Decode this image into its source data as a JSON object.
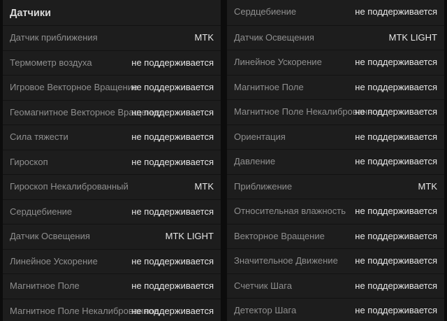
{
  "left": {
    "title": "Датчики",
    "rows": [
      {
        "label": "Датчик приближения",
        "value": "MTK"
      },
      {
        "label": "Термометр воздуха",
        "value": "не поддерживается"
      },
      {
        "label": "Игровое Векторное Вращение",
        "value": "не поддерживается"
      },
      {
        "label": "Геомагнитное Векторное Вращение",
        "value": "не поддерживается"
      },
      {
        "label": "Сила тяжести",
        "value": "не поддерживается"
      },
      {
        "label": "Гироскоп",
        "value": "не поддерживается"
      },
      {
        "label": "Гироскоп Некалиброванный",
        "value": "MTK"
      },
      {
        "label": "Сердцебиение",
        "value": "не поддерживается"
      },
      {
        "label": "Датчик Освещения",
        "value": "MTK LIGHT"
      },
      {
        "label": "Линейное Ускорение",
        "value": "не поддерживается"
      },
      {
        "label": "Магнитное Поле",
        "value": "не поддерживается"
      },
      {
        "label": "Магнитное Поле Некалиброванное",
        "value": "не поддерживается"
      }
    ]
  },
  "right": {
    "rows": [
      {
        "label": "Сердцебиение",
        "value": "не поддерживается"
      },
      {
        "label": "Датчик Освещения",
        "value": "MTK LIGHT"
      },
      {
        "label": "Линейное Ускорение",
        "value": "не поддерживается"
      },
      {
        "label": "Магнитное Поле",
        "value": "не поддерживается"
      },
      {
        "label": "Магнитное Поле Некалиброванное",
        "value": "не поддерживается"
      },
      {
        "label": "Ориентация",
        "value": "не поддерживается"
      },
      {
        "label": "Давление",
        "value": "не поддерживается"
      },
      {
        "label": "Приближение",
        "value": "MTK"
      },
      {
        "label": "Относительная влажность",
        "value": "не поддерживается"
      },
      {
        "label": "Векторное Вращение",
        "value": "не поддерживается"
      },
      {
        "label": "Значительное Движение",
        "value": "не поддерживается"
      },
      {
        "label": "Счетчик Шага",
        "value": "не поддерживается"
      },
      {
        "label": "Детектор Шага",
        "value": "не поддерживается"
      }
    ]
  }
}
